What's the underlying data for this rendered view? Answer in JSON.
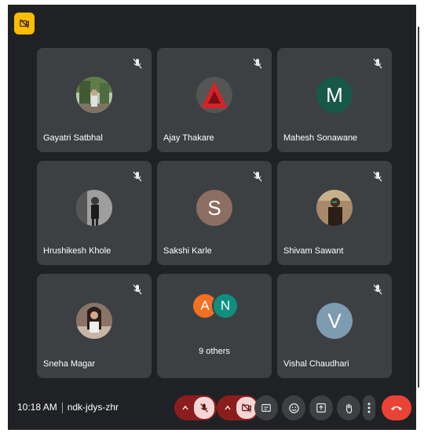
{
  "participants": [
    {
      "name": "Gayatri Satbhal",
      "avatar": "photo"
    },
    {
      "name": "Ajay Thakare",
      "avatar": "logo"
    },
    {
      "name": "Mahesh Sonawane",
      "avatar": "M",
      "color": "#17584a"
    },
    {
      "name": "Hrushikesh Khole",
      "avatar": "photo"
    },
    {
      "name": "Sakshi Karle",
      "avatar": "S",
      "color": "#8d6e63"
    },
    {
      "name": "Shivam Sawant",
      "avatar": "photo"
    },
    {
      "name": "Sneha Magar",
      "avatar": "photo"
    },
    {
      "name": "Vishal Chaudhari",
      "avatar": "V",
      "color": "#7e9cb0"
    }
  ],
  "others": {
    "initials": [
      "A",
      "N"
    ],
    "colors": [
      "#f36f21",
      "#0f8f7e"
    ],
    "label": "9 others"
  },
  "meeting": {
    "time": "10:18 AM",
    "code": "ndk-jdys-zhr"
  },
  "colors": {
    "background": "#202124",
    "tile": "#3c4043",
    "end_call": "#ea4335",
    "muted_pill": "#8b1d1d",
    "badge": "#fbbc04"
  },
  "controls": [
    "microphone-off",
    "camera-off",
    "captions",
    "emoji",
    "present",
    "raise-hand",
    "more-options",
    "end-call"
  ]
}
